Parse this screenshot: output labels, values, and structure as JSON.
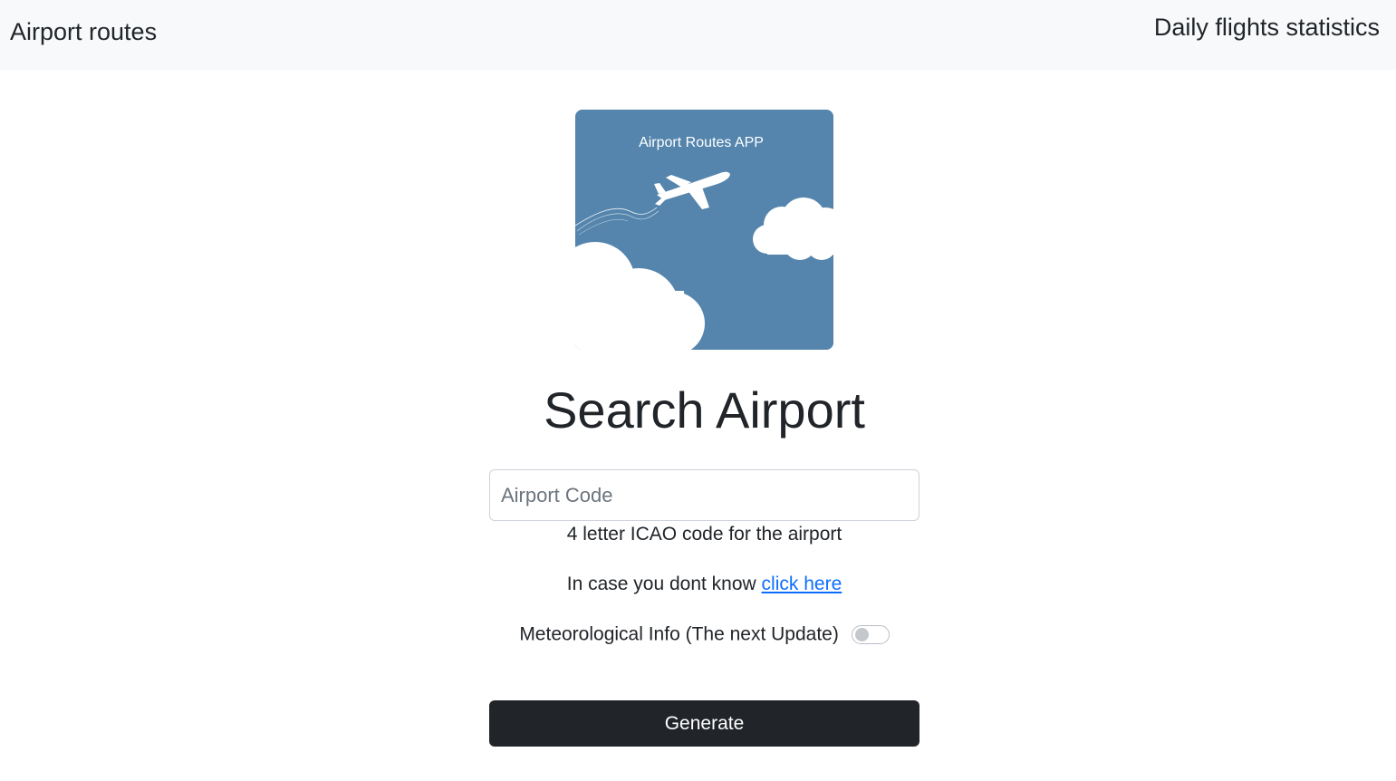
{
  "navbar": {
    "brand": "Airport routes",
    "right_link": "Daily flights statistics"
  },
  "logo": {
    "text": "Airport Routes APP",
    "background_color": "#5585ad",
    "icon": "airplane-icon"
  },
  "main": {
    "title": "Search Airport",
    "airport_input": {
      "placeholder": "Airport Code",
      "value": ""
    },
    "help_text": "4 letter ICAO code for the airport",
    "hint_prefix": "In case you dont know",
    "hint_link": "click here",
    "meteo_label": "Meteorological Info (The next Update)",
    "meteo_enabled": false,
    "generate_label": "Generate"
  },
  "colors": {
    "navbar_bg": "#f8f9fa",
    "button_bg": "#212529",
    "link": "#0d6efd"
  }
}
